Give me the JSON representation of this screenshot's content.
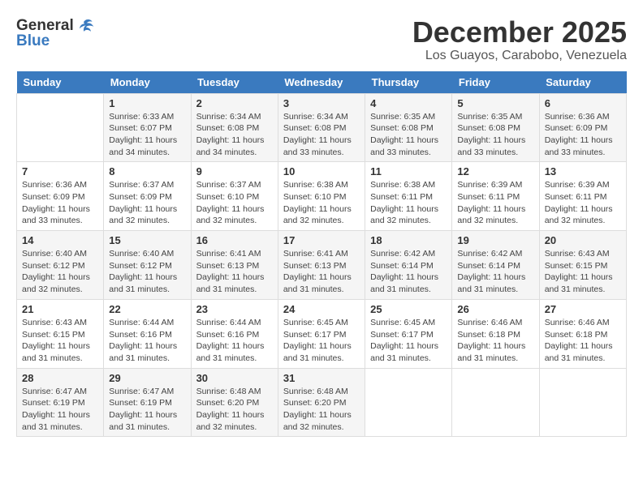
{
  "logo": {
    "general": "General",
    "blue": "Blue"
  },
  "title": "December 2025",
  "location": "Los Guayos, Carabobo, Venezuela",
  "calendar": {
    "headers": [
      "Sunday",
      "Monday",
      "Tuesday",
      "Wednesday",
      "Thursday",
      "Friday",
      "Saturday"
    ],
    "weeks": [
      [
        {
          "day": "",
          "info": ""
        },
        {
          "day": "1",
          "info": "Sunrise: 6:33 AM\nSunset: 6:07 PM\nDaylight: 11 hours and 34 minutes."
        },
        {
          "day": "2",
          "info": "Sunrise: 6:34 AM\nSunset: 6:08 PM\nDaylight: 11 hours and 34 minutes."
        },
        {
          "day": "3",
          "info": "Sunrise: 6:34 AM\nSunset: 6:08 PM\nDaylight: 11 hours and 33 minutes."
        },
        {
          "day": "4",
          "info": "Sunrise: 6:35 AM\nSunset: 6:08 PM\nDaylight: 11 hours and 33 minutes."
        },
        {
          "day": "5",
          "info": "Sunrise: 6:35 AM\nSunset: 6:08 PM\nDaylight: 11 hours and 33 minutes."
        },
        {
          "day": "6",
          "info": "Sunrise: 6:36 AM\nSunset: 6:09 PM\nDaylight: 11 hours and 33 minutes."
        }
      ],
      [
        {
          "day": "7",
          "info": "Sunrise: 6:36 AM\nSunset: 6:09 PM\nDaylight: 11 hours and 33 minutes."
        },
        {
          "day": "8",
          "info": "Sunrise: 6:37 AM\nSunset: 6:09 PM\nDaylight: 11 hours and 32 minutes."
        },
        {
          "day": "9",
          "info": "Sunrise: 6:37 AM\nSunset: 6:10 PM\nDaylight: 11 hours and 32 minutes."
        },
        {
          "day": "10",
          "info": "Sunrise: 6:38 AM\nSunset: 6:10 PM\nDaylight: 11 hours and 32 minutes."
        },
        {
          "day": "11",
          "info": "Sunrise: 6:38 AM\nSunset: 6:11 PM\nDaylight: 11 hours and 32 minutes."
        },
        {
          "day": "12",
          "info": "Sunrise: 6:39 AM\nSunset: 6:11 PM\nDaylight: 11 hours and 32 minutes."
        },
        {
          "day": "13",
          "info": "Sunrise: 6:39 AM\nSunset: 6:11 PM\nDaylight: 11 hours and 32 minutes."
        }
      ],
      [
        {
          "day": "14",
          "info": "Sunrise: 6:40 AM\nSunset: 6:12 PM\nDaylight: 11 hours and 32 minutes."
        },
        {
          "day": "15",
          "info": "Sunrise: 6:40 AM\nSunset: 6:12 PM\nDaylight: 11 hours and 31 minutes."
        },
        {
          "day": "16",
          "info": "Sunrise: 6:41 AM\nSunset: 6:13 PM\nDaylight: 11 hours and 31 minutes."
        },
        {
          "day": "17",
          "info": "Sunrise: 6:41 AM\nSunset: 6:13 PM\nDaylight: 11 hours and 31 minutes."
        },
        {
          "day": "18",
          "info": "Sunrise: 6:42 AM\nSunset: 6:14 PM\nDaylight: 11 hours and 31 minutes."
        },
        {
          "day": "19",
          "info": "Sunrise: 6:42 AM\nSunset: 6:14 PM\nDaylight: 11 hours and 31 minutes."
        },
        {
          "day": "20",
          "info": "Sunrise: 6:43 AM\nSunset: 6:15 PM\nDaylight: 11 hours and 31 minutes."
        }
      ],
      [
        {
          "day": "21",
          "info": "Sunrise: 6:43 AM\nSunset: 6:15 PM\nDaylight: 11 hours and 31 minutes."
        },
        {
          "day": "22",
          "info": "Sunrise: 6:44 AM\nSunset: 6:16 PM\nDaylight: 11 hours and 31 minutes."
        },
        {
          "day": "23",
          "info": "Sunrise: 6:44 AM\nSunset: 6:16 PM\nDaylight: 11 hours and 31 minutes."
        },
        {
          "day": "24",
          "info": "Sunrise: 6:45 AM\nSunset: 6:17 PM\nDaylight: 11 hours and 31 minutes."
        },
        {
          "day": "25",
          "info": "Sunrise: 6:45 AM\nSunset: 6:17 PM\nDaylight: 11 hours and 31 minutes."
        },
        {
          "day": "26",
          "info": "Sunrise: 6:46 AM\nSunset: 6:18 PM\nDaylight: 11 hours and 31 minutes."
        },
        {
          "day": "27",
          "info": "Sunrise: 6:46 AM\nSunset: 6:18 PM\nDaylight: 11 hours and 31 minutes."
        }
      ],
      [
        {
          "day": "28",
          "info": "Sunrise: 6:47 AM\nSunset: 6:19 PM\nDaylight: 11 hours and 31 minutes."
        },
        {
          "day": "29",
          "info": "Sunrise: 6:47 AM\nSunset: 6:19 PM\nDaylight: 11 hours and 31 minutes."
        },
        {
          "day": "30",
          "info": "Sunrise: 6:48 AM\nSunset: 6:20 PM\nDaylight: 11 hours and 32 minutes."
        },
        {
          "day": "31",
          "info": "Sunrise: 6:48 AM\nSunset: 6:20 PM\nDaylight: 11 hours and 32 minutes."
        },
        {
          "day": "",
          "info": ""
        },
        {
          "day": "",
          "info": ""
        },
        {
          "day": "",
          "info": ""
        }
      ]
    ]
  }
}
